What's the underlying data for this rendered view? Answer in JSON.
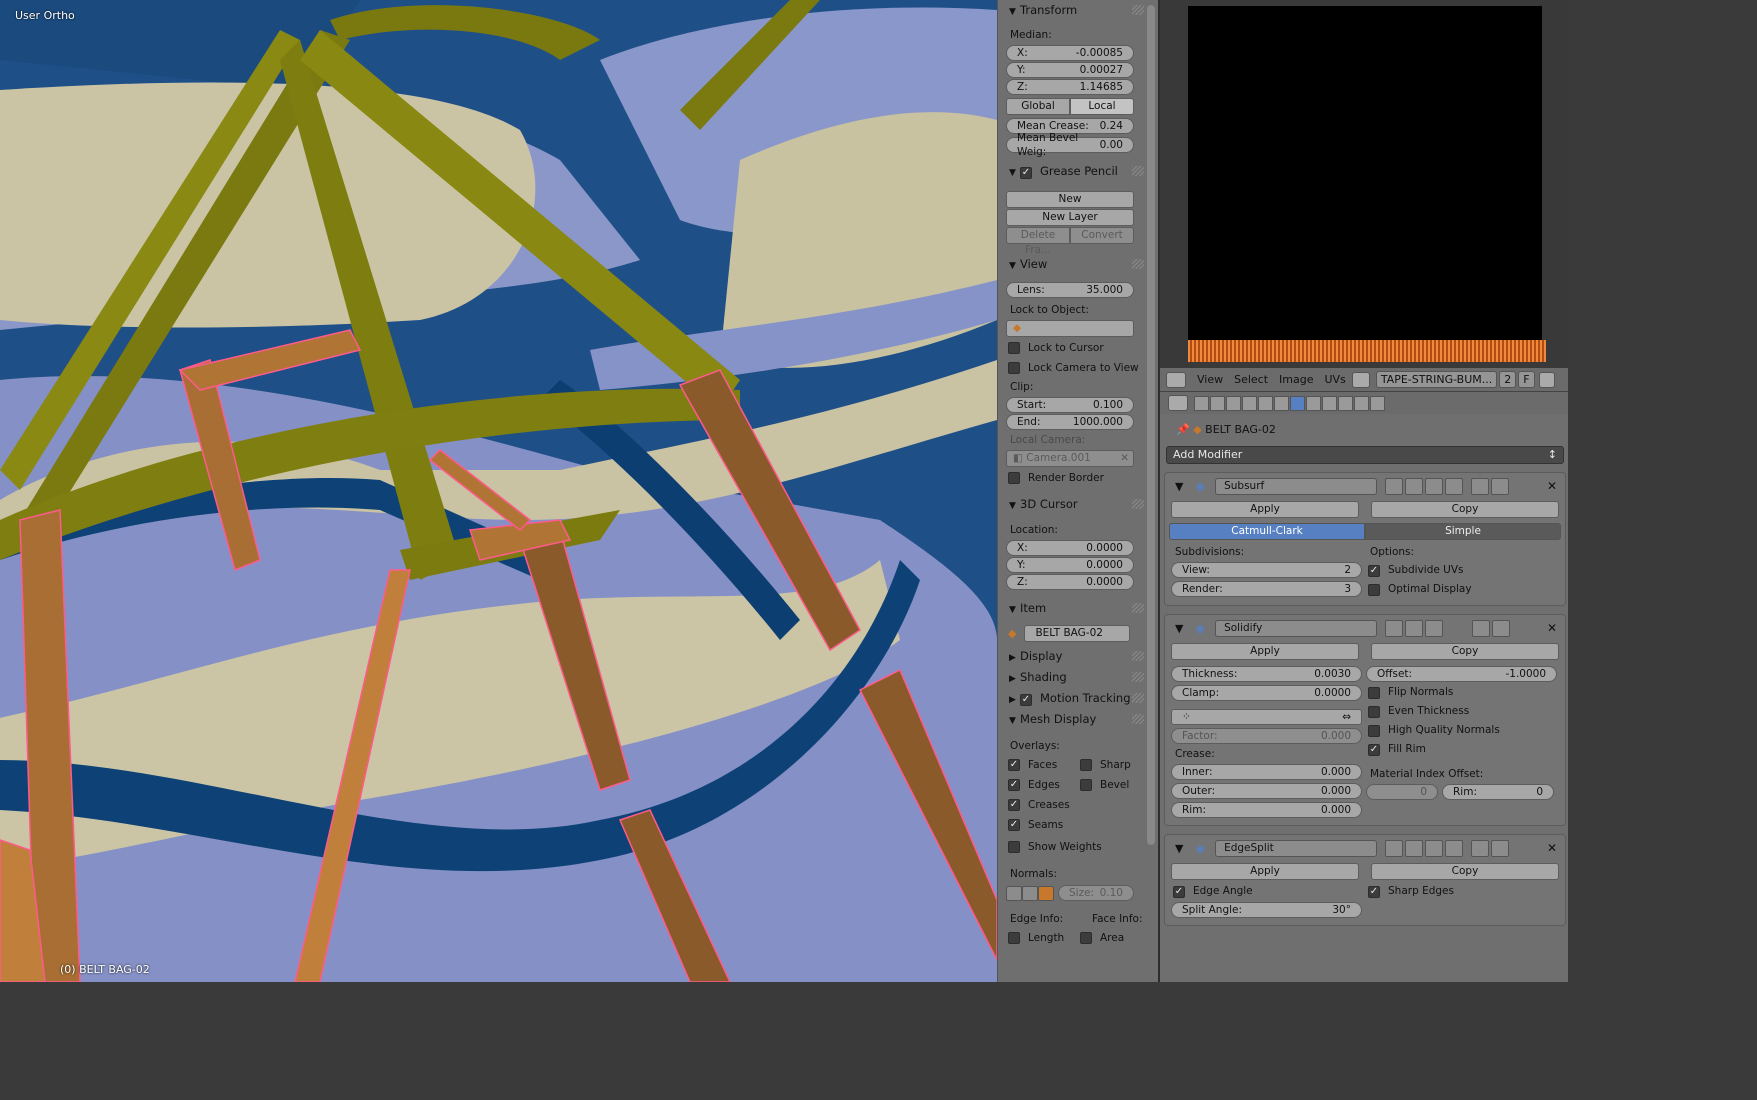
{
  "viewport": {
    "mode_label": "User Ortho",
    "object_label": "(0) BELT BAG-02"
  },
  "npanel": {
    "transform": {
      "title": "Transform",
      "median_label": "Median:",
      "x": {
        "label": "X:",
        "value": "-0.00085"
      },
      "y": {
        "label": "Y:",
        "value": "0.00027"
      },
      "z": {
        "label": "Z:",
        "value": "1.14685"
      },
      "global": "Global",
      "local": "Local",
      "mean_crease": {
        "label": "Mean Crease:",
        "value": "0.24"
      },
      "mean_bevel": {
        "label": "Mean Bevel Weig:",
        "value": "0.00"
      }
    },
    "grease_pencil": {
      "title": "Grease Pencil",
      "enabled": true,
      "new": "New",
      "new_layer": "New Layer",
      "delete_frame": "Delete Fra...",
      "convert": "Convert"
    },
    "view": {
      "title": "View",
      "lens": {
        "label": "Lens:",
        "value": "35.000"
      },
      "lock_to_object": "Lock to Object:",
      "lock_to_cursor": "Lock to Cursor",
      "lock_camera": "Lock Camera to View",
      "clip": "Clip:",
      "start": {
        "label": "Start:",
        "value": "0.100"
      },
      "end": {
        "label": "End:",
        "value": "1000.000"
      },
      "local_camera": "Local Camera:",
      "camera": "Camera.001",
      "render_border": "Render Border"
    },
    "cursor": {
      "title": "3D Cursor",
      "location": "Location:",
      "x": {
        "label": "X:",
        "value": "0.0000"
      },
      "y": {
        "label": "Y:",
        "value": "0.0000"
      },
      "z": {
        "label": "Z:",
        "value": "0.0000"
      }
    },
    "item": {
      "title": "Item",
      "name": "BELT BAG-02"
    },
    "display": "Display",
    "shading": "Shading",
    "motion_tracking": "Motion Tracking",
    "mesh_display": {
      "title": "Mesh Display",
      "overlays": "Overlays:",
      "faces": "Faces",
      "sharp": "Sharp",
      "edges": "Edges",
      "bevel": "Bevel",
      "creases": "Creases",
      "seams": "Seams",
      "show_weights": "Show Weights",
      "normals": "Normals:",
      "size": {
        "label": "Size:",
        "value": "0.10"
      },
      "edge_info": "Edge Info:",
      "face_info": "Face Info:",
      "length": "Length",
      "area": "Area"
    }
  },
  "uv_header": {
    "view": "View",
    "select": "Select",
    "image": "Image",
    "uvs": "UVs",
    "image_name": "TAPE-STRING-BUM...",
    "users": "2",
    "fake": "F"
  },
  "props": {
    "object_name": "BELT BAG-02",
    "add_modifier": "Add Modifier",
    "apply": "Apply",
    "copy": "Copy",
    "subsurf": {
      "name": "Subsurf",
      "catmull": "Catmull-Clark",
      "simple": "Simple",
      "subdivisions": "Subdivisions:",
      "options": "Options:",
      "view": {
        "label": "View:",
        "value": "2"
      },
      "render": {
        "label": "Render:",
        "value": "3"
      },
      "subdivide_uvs": "Subdivide UVs",
      "optimal_display": "Optimal Display"
    },
    "solidify": {
      "name": "Solidify",
      "thickness": {
        "label": "Thickness:",
        "value": "0.0030"
      },
      "offset": {
        "label": "Offset:",
        "value": "-1.0000"
      },
      "clamp": {
        "label": "Clamp:",
        "value": "0.0000"
      },
      "flip_normals": "Flip Normals",
      "even_thickness": "Even Thickness",
      "high_quality": "High Quality Normals",
      "fill_rim": "Fill Rim",
      "factor": {
        "label": "Factor:",
        "value": "0.000"
      },
      "crease": "Crease:",
      "inner": {
        "label": "Inner:",
        "value": "0.000"
      },
      "outer": {
        "label": "Outer:",
        "value": "0.000"
      },
      "rim": {
        "label": "Rim:",
        "value": "0.000"
      },
      "material_offset": "Material Index Offset:",
      "mat_value": "0",
      "mat_rim": {
        "label": "Rim:",
        "value": "0"
      }
    },
    "edgesplit": {
      "name": "EdgeSplit",
      "edge_angle": "Edge Angle",
      "sharp_edges": "Sharp Edges",
      "split_angle": {
        "label": "Split Angle:",
        "value": "30°"
      }
    }
  }
}
